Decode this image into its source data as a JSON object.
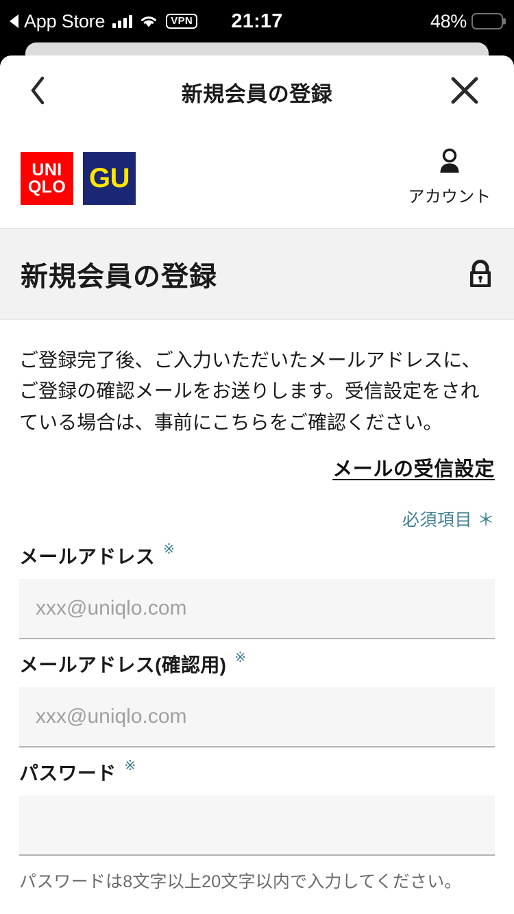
{
  "status_bar": {
    "back_app_label": "App Store",
    "back_arrow_icon": "triangle-left-icon",
    "cellular_icon": "signal-bars-icon",
    "wifi_icon": "wifi-icon",
    "vpn_badge": "VPN",
    "time": "21:17",
    "battery_percent": "48%",
    "battery_icon": "battery-low-power-icon",
    "battery_fill_color": "#ffcc00"
  },
  "modal": {
    "back_icon": "chevron-left-icon",
    "title": "新規会員の登録",
    "close_icon": "close-x-icon"
  },
  "brand_bar": {
    "uniqlo_logo": {
      "line1": "UNI",
      "line2": "QLO",
      "bg_color": "#ff0000",
      "text_color": "#ffffff"
    },
    "gu_logo": {
      "text": "GU",
      "bg_color": "#1b2674",
      "text_color": "#ffe600"
    },
    "account": {
      "icon": "person-icon",
      "label": "アカウント"
    }
  },
  "page": {
    "title": "新規会員の登録",
    "secure_icon": "lock-icon",
    "title_band_bg": "#f2f2f2"
  },
  "body": {
    "lead_text": "ご登録完了後、ご入力いただいたメールアドレスに、ご登録の確認メールをお送りします。受信設定をされている場合は、事前にこちらをご確認ください。",
    "mail_settings_link": "メールの受信設定",
    "required_note": "必須項目 ＊",
    "required_mark": "※",
    "accent_color": "#3d7e93"
  },
  "fields": [
    {
      "label": "メールアドレス",
      "required_mark": "※",
      "value": "",
      "placeholder": "xxx@uniqlo.com",
      "helper": ""
    },
    {
      "label": "メールアドレス(確認用)",
      "required_mark": "※",
      "value": "",
      "placeholder": "xxx@uniqlo.com",
      "helper": ""
    },
    {
      "label": "パスワード",
      "required_mark": "※",
      "value": "",
      "placeholder": "",
      "helper": "パスワードは8文字以上20文字以内で入力してください。"
    }
  ]
}
